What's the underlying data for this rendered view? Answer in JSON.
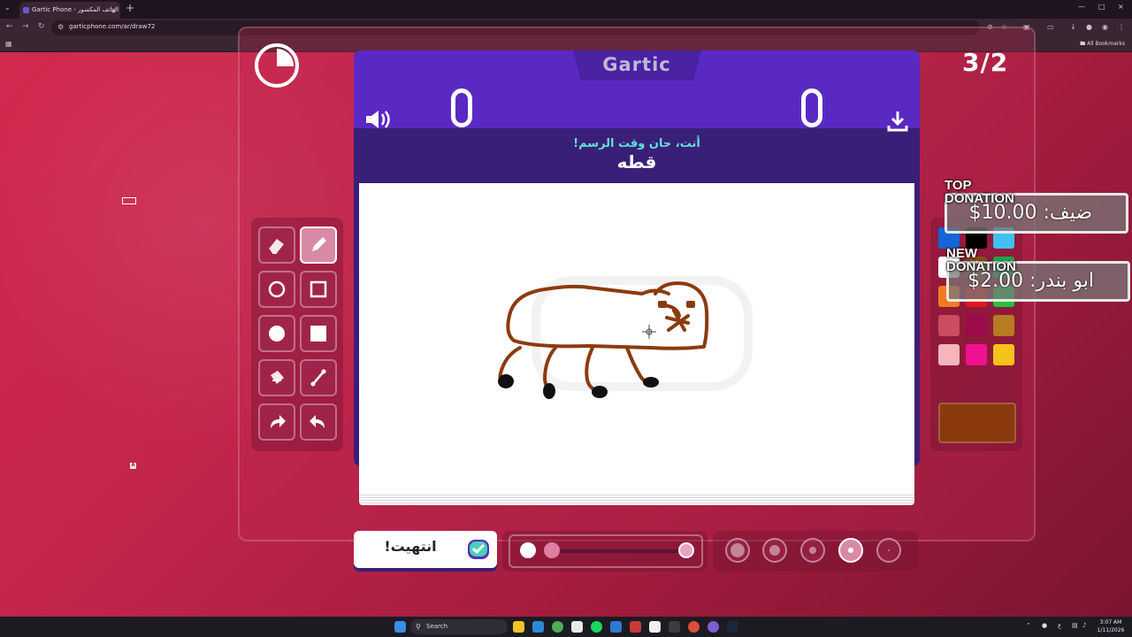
{
  "browser": {
    "tab_title": "Gartic Phone - الهاتف المكسور",
    "url": "garticphone.com/ar/draw72",
    "bookmarks_label": "All Bookmarks"
  },
  "game": {
    "logo": "Gartic",
    "round_counter": "3/2",
    "prompt_label": "أنت، حان وقت الرسم!",
    "word": "قطه",
    "done_button": "انتهيت!",
    "opacity_slider_value": 0.0,
    "selected_brush_size_index": 3
  },
  "tools": [
    {
      "name": "eraser-tool",
      "icon": "eraser-icon"
    },
    {
      "name": "pencil-tool",
      "icon": "pencil-icon",
      "active": true
    },
    {
      "name": "ellipse-outline-tool",
      "icon": "circle-outline-icon"
    },
    {
      "name": "rect-outline-tool",
      "icon": "square-outline-icon"
    },
    {
      "name": "ellipse-fill-tool",
      "icon": "circle-fill-icon"
    },
    {
      "name": "rect-fill-tool",
      "icon": "square-fill-icon"
    },
    {
      "name": "bucket-tool",
      "icon": "bucket-icon"
    },
    {
      "name": "line-tool",
      "icon": "line-icon"
    },
    {
      "name": "redo-tool",
      "icon": "redo-icon"
    },
    {
      "name": "undo-tool",
      "icon": "undo-icon"
    }
  ],
  "palette": [
    "#1565d8",
    "#000000",
    "#3ec1f0",
    "#ffffff",
    "#8b4a14",
    "#19a84c",
    "#f47a20",
    "#e8141e",
    "#24c23e",
    "#c94d5e",
    "#9a0c4a",
    "#b87b22",
    "#f6b4bb",
    "#ee1290",
    "#f4c21a"
  ],
  "selected_color": "#8b3a0e",
  "donations": {
    "top_label": "TOP DONATION",
    "top_text": "ضيف: 10.00$",
    "new_label": "NEW DONATION",
    "new_text": "ابو بندر: 2.00$"
  },
  "taskbar": {
    "search_label": "Search",
    "time": "3:07 AM",
    "date": "1/11/2026"
  }
}
